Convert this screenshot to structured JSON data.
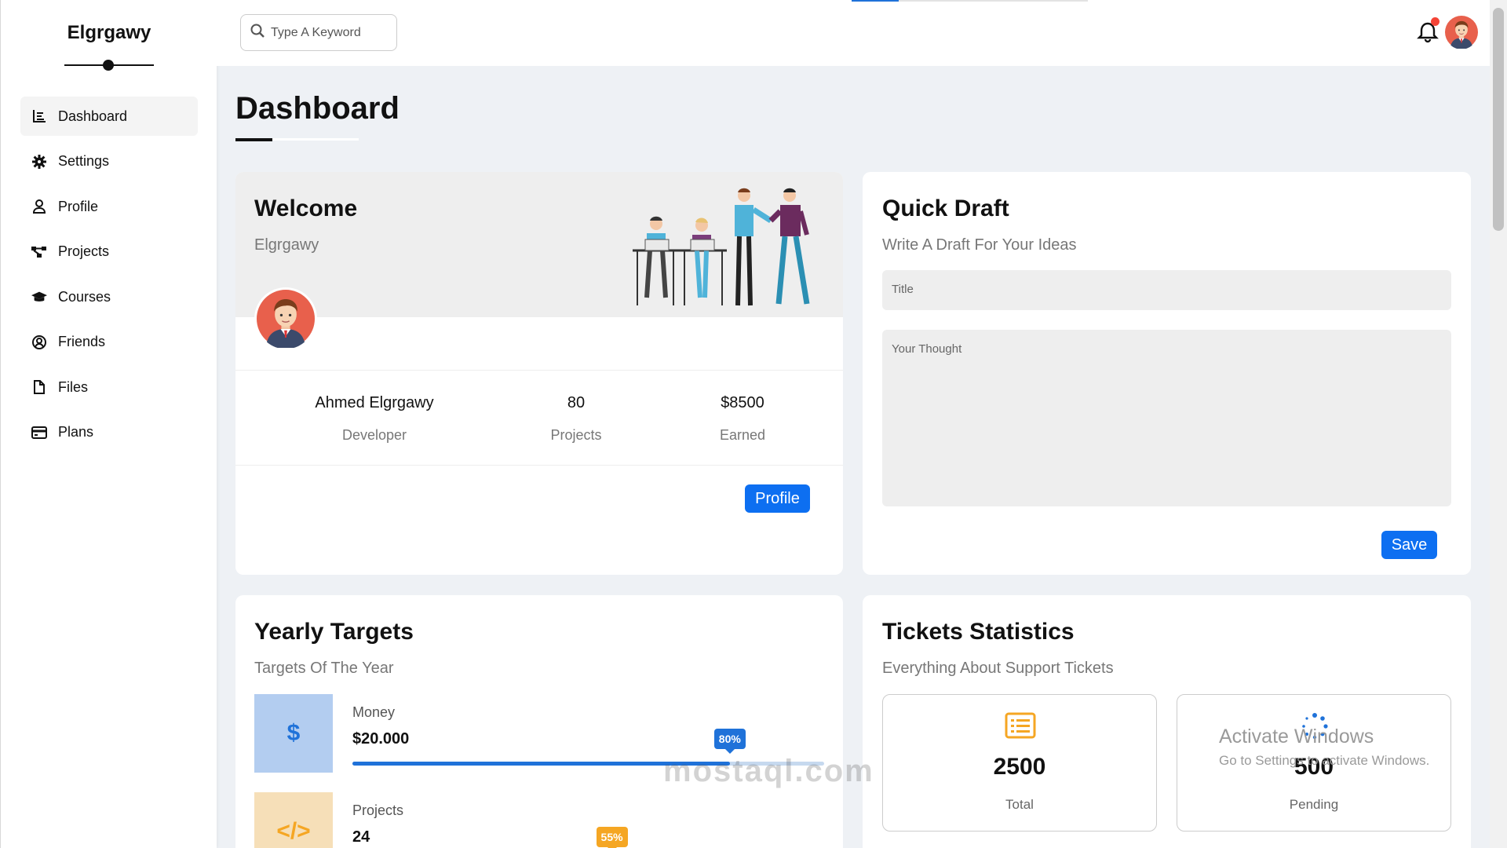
{
  "app": {
    "brand": "Elgrgawy"
  },
  "sidebar": {
    "items": [
      {
        "label": "Dashboard",
        "icon": "chart-icon"
      },
      {
        "label": "Settings",
        "icon": "gear-icon"
      },
      {
        "label": "Profile",
        "icon": "user-icon"
      },
      {
        "label": "Projects",
        "icon": "diagram-icon"
      },
      {
        "label": "Courses",
        "icon": "graduation-cap-icon"
      },
      {
        "label": "Friends",
        "icon": "user-circle-icon"
      },
      {
        "label": "Files",
        "icon": "file-icon"
      },
      {
        "label": "Plans",
        "icon": "credit-card-icon"
      }
    ]
  },
  "header": {
    "search_placeholder": "Type A Keyword",
    "has_notification": true
  },
  "page": {
    "title": "Dashboard"
  },
  "welcome": {
    "title": "Welcome",
    "username": "Elgrgawy",
    "stats": [
      {
        "value": "Ahmed Elgrgawy",
        "label": "Developer"
      },
      {
        "value": "80",
        "label": "Projects"
      },
      {
        "value": "$8500",
        "label": "Earned"
      }
    ],
    "button": "Profile"
  },
  "draft": {
    "title": "Quick Draft",
    "subtitle": "Write A Draft For Your Ideas",
    "title_placeholder": "Title",
    "thought_placeholder": "Your Thought",
    "button": "Save"
  },
  "targets": {
    "title": "Yearly Targets",
    "subtitle": "Targets Of The Year",
    "items": [
      {
        "name": "Money",
        "value": "$20.000",
        "percent": 80,
        "percent_label": "80%",
        "icon": "dollar-icon",
        "color": "#1f72d9",
        "bg": "#b3cdf0"
      },
      {
        "name": "Projects",
        "value": "24",
        "percent": 55,
        "percent_label": "55%",
        "icon": "code-icon",
        "color": "#f5a623",
        "bg": "#f6dfb8"
      }
    ]
  },
  "tickets": {
    "title": "Tickets Statistics",
    "subtitle": "Everything About Support Tickets",
    "items": [
      {
        "value": "2500",
        "label": "Total",
        "icon": "list-icon"
      },
      {
        "value": "500",
        "label": "Pending",
        "icon": "spinner-icon"
      }
    ]
  },
  "watermarks": {
    "windows_title": "Activate Windows",
    "windows_sub": "Go to Settings to activate Windows.",
    "site": "mostaql.com"
  },
  "colors": {
    "accent": "#0d6ff1",
    "progress_blue": "#1f72d9",
    "progress_orange": "#f5a623",
    "notification": "#f44336"
  }
}
